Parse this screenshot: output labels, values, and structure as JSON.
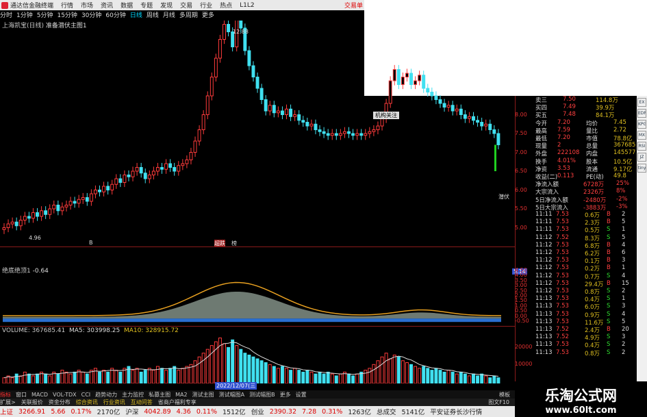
{
  "app": {
    "title": "通达信金融终端",
    "menus": [
      "行情",
      "市场",
      "资讯",
      "数据",
      "专题",
      "发现",
      "交易",
      "行业",
      "热点",
      "L1L2"
    ],
    "trade_label": "交易单"
  },
  "periods": [
    "分时",
    "1分钟",
    "5分钟",
    "15分钟",
    "30分钟",
    "60分钟",
    "日线",
    "周线",
    "月线",
    "多周期",
    "更多"
  ],
  "active_period": "日线",
  "chart": {
    "stock": "上海凯宝(日线)",
    "indicator": "准备潜伏主图1",
    "high_label": "12.88",
    "low_label": "4.96",
    "trend_label": "潜伏",
    "float_tags": [
      "B",
      "超跌",
      "榜"
    ],
    "popup": "机构关注"
  },
  "chart_data": [
    {
      "type": "candlestick",
      "title": "上海凯宝(日线)",
      "ylim": [
        4.5,
        10.5
      ],
      "yticks": [
        10,
        9.5,
        9,
        8.5,
        8,
        7.5,
        7,
        6.5,
        6,
        5.5,
        5
      ],
      "close": [
        5.0,
        5.1,
        5.15,
        5.05,
        5.2,
        5.3,
        5.25,
        5.4,
        5.3,
        5.45,
        5.35,
        5.5,
        5.6,
        5.45,
        5.55,
        5.6,
        5.7,
        5.65,
        5.75,
        5.8,
        5.7,
        5.9,
        6.0,
        5.95,
        6.1,
        6.0,
        6.15,
        6.3,
        6.2,
        6.4,
        6.35,
        6.5,
        6.6,
        6.45,
        6.3,
        6.4,
        6.5,
        6.6,
        6.55,
        6.7,
        6.6,
        6.5,
        6.65,
        6.7,
        6.8,
        7.0,
        7.3,
        7.6,
        8.0,
        8.5,
        9.0,
        9.5,
        10.0,
        10.4,
        10.2,
        9.8,
        10.6,
        10.3,
        9.7,
        9.3,
        9.0,
        8.7,
        8.4,
        8.1,
        8.25,
        8.05,
        8.1,
        8.0,
        8.15,
        7.95,
        8.0,
        7.85,
        7.8,
        7.7,
        7.75,
        7.6,
        7.55,
        7.5,
        7.45,
        7.5,
        7.45,
        7.5,
        7.55,
        7.5,
        7.45,
        7.5,
        7.45,
        7.5,
        7.55,
        7.6,
        7.7,
        7.9,
        8.3,
        8.9,
        9.2,
        8.8,
        9.0,
        9.1,
        8.8,
        8.9,
        9.05,
        8.7,
        8.6,
        8.5,
        8.4,
        8.3,
        8.2,
        8.25,
        8.1,
        8.15,
        8.0,
        7.9,
        7.95,
        7.85,
        7.8,
        7.7,
        7.75,
        7.6,
        7.5,
        7.2
      ],
      "open": [
        4.95,
        5.0,
        5.1,
        5.15,
        5.05,
        5.2,
        5.3,
        5.25,
        5.4,
        5.3,
        5.45,
        5.35,
        5.5,
        5.6,
        5.45,
        5.55,
        5.6,
        5.7,
        5.65,
        5.75,
        5.8,
        5.7,
        5.9,
        6.0,
        5.95,
        6.1,
        6.0,
        6.15,
        6.3,
        6.2,
        6.4,
        6.35,
        6.5,
        6.6,
        6.45,
        6.3,
        6.4,
        6.5,
        6.6,
        6.55,
        6.7,
        6.6,
        6.5,
        6.65,
        6.7,
        6.8,
        7.0,
        7.3,
        7.6,
        8.0,
        8.5,
        9.0,
        9.5,
        10.0,
        10.4,
        10.2,
        9.8,
        10.6,
        10.3,
        9.7,
        9.3,
        9.0,
        8.7,
        8.4,
        8.1,
        8.25,
        8.05,
        8.1,
        8.0,
        8.15,
        7.95,
        8.0,
        7.85,
        7.8,
        7.7,
        7.75,
        7.6,
        7.55,
        7.5,
        7.45,
        7.5,
        7.45,
        7.5,
        7.55,
        7.5,
        7.45,
        7.5,
        7.45,
        7.5,
        7.55,
        7.6,
        7.7,
        7.9,
        8.3,
        8.9,
        9.2,
        8.8,
        9.0,
        9.1,
        8.8,
        8.9,
        9.05,
        8.7,
        8.6,
        8.5,
        8.4,
        8.3,
        8.2,
        8.25,
        8.1,
        8.15,
        8.0,
        7.9,
        7.95,
        7.85,
        7.8,
        7.7,
        7.75,
        7.6,
        7.5
      ],
      "volume": [
        3,
        4,
        3,
        5,
        4,
        6,
        5,
        4,
        5,
        6,
        5,
        4,
        6,
        5,
        7,
        6,
        5,
        6,
        7,
        6,
        5,
        7,
        8,
        6,
        7,
        6,
        8,
        7,
        6,
        8,
        9,
        7,
        8,
        6,
        7,
        8,
        7,
        9,
        8,
        7,
        8,
        9,
        7,
        8,
        9,
        10,
        12,
        14,
        16,
        18,
        20,
        22,
        24,
        21,
        19,
        23,
        20,
        18,
        16,
        15,
        14,
        13,
        12,
        11,
        10,
        9,
        8,
        9,
        8,
        7,
        8,
        7,
        6,
        7,
        6,
        5,
        6,
        5,
        6,
        5,
        4,
        5,
        6,
        5,
        4,
        5,
        6,
        7,
        8,
        10,
        12,
        14,
        16,
        13,
        15,
        14,
        12,
        11,
        10,
        9,
        8,
        9,
        8,
        7,
        8,
        7,
        6,
        7,
        6,
        5,
        6,
        5,
        4,
        5,
        4,
        5,
        4,
        3,
        4,
        3,
        4
      ]
    },
    {
      "type": "area",
      "title": "绝底绝顶1",
      "value_label": "-0.64",
      "yticks": [
        4.5,
        4.0,
        3.5,
        3.0,
        2.5,
        2.0,
        1.5,
        1.0,
        0.5,
        0.0,
        -0.5
      ],
      "current": "5.14"
    },
    {
      "type": "bar",
      "title": "VOLUME",
      "volume": "367685.41",
      "ma5": "303998.25",
      "ma10": "328915.72",
      "yticks": [
        "20000",
        "10000"
      ],
      "date_label": "2022/12/07(三"
    }
  ],
  "quote": {
    "asks": [
      {
        "label": "卖三",
        "price": "7.50",
        "vol": "114.8万"
      },
      {
        "label": "买四",
        "price": "7.49",
        "vol": "39.9万"
      },
      {
        "label": "买五",
        "price": "7.48",
        "vol": "84.1万"
      }
    ],
    "stats": [
      [
        "今开",
        "7.20",
        "均价",
        "7.45"
      ],
      [
        "最高",
        "7.59",
        "量比",
        "2.72"
      ],
      [
        "最低",
        "7.20",
        "市值",
        "78.8亿"
      ],
      [
        "现量",
        "2",
        "总量",
        "367685"
      ],
      [
        "外盘",
        "222108",
        "内盘",
        "145577"
      ],
      [
        "换手",
        "4.01%",
        "股本",
        "10.5亿"
      ],
      [
        "净资",
        "3.53",
        "流通",
        "9.17亿"
      ],
      [
        "收益(二)",
        "0.113",
        "PE(动)",
        "49.8"
      ]
    ],
    "flows": [
      [
        "净流入额",
        "6728万",
        "25%"
      ],
      [
        "大宗流入",
        "2326万",
        "8%"
      ],
      [
        "5日净流入额",
        "-2480万",
        "-2%"
      ],
      [
        "5日大宗流入",
        "-3883万",
        "-3%"
      ]
    ],
    "ticks": [
      [
        "11:11",
        "7.53",
        "0.6万",
        "B",
        "2"
      ],
      [
        "11:11",
        "7.53",
        "2.3万",
        "B",
        "5"
      ],
      [
        "11:11",
        "7.53",
        "0.5万",
        "S",
        "1"
      ],
      [
        "11:12",
        "7.52",
        "8.3万",
        "S",
        "5"
      ],
      [
        "11:12",
        "7.53",
        "6.8万",
        "B",
        "4"
      ],
      [
        "11:12",
        "7.53",
        "6.2万",
        "B",
        "6"
      ],
      [
        "11:12",
        "7.53",
        "0.1万",
        "B",
        "3"
      ],
      [
        "11:12",
        "7.53",
        "0.2万",
        "B",
        "1"
      ],
      [
        "11:12",
        "7.53",
        "0.7万",
        "S",
        "4"
      ],
      [
        "11:12",
        "7.53",
        "29.4万",
        "B",
        "15"
      ],
      [
        "11:12",
        "7.53",
        "0.8万",
        "S",
        "2"
      ],
      [
        "11:13",
        "7.53",
        "0.4万",
        "S",
        "1"
      ],
      [
        "11:13",
        "7.53",
        "6.0万",
        "S",
        "3"
      ],
      [
        "11:13",
        "7.53",
        "0.9万",
        "S",
        "4"
      ],
      [
        "11:13",
        "7.53",
        "11.6万",
        "S",
        "5"
      ],
      [
        "11:13",
        "7.52",
        "2.4万",
        "B",
        "20"
      ],
      [
        "11:13",
        "7.52",
        "4.9万",
        "S",
        "3"
      ],
      [
        "11:13",
        "7.53",
        "0.4万",
        "S",
        "2"
      ],
      [
        "11:13",
        "7.53",
        "0.8万",
        "S",
        "2"
      ]
    ]
  },
  "tabs": [
    "指标",
    "窗口",
    "MACD",
    "VOL-TDX",
    "CCI",
    "趋势动力",
    "主力监控",
    "私募主图",
    "MA2",
    "测试主图",
    "测试幅图A",
    "测试幅图B",
    "更多",
    "设置"
  ],
  "tabs_right": "模板",
  "ext_tabs": [
    "扩展>",
    "关联报价",
    "资金分布",
    "综合资讯",
    "行业资讯",
    "互动问答",
    "省商户福利专享"
  ],
  "ext_right": "图文F10",
  "status": [
    {
      "name": "上证",
      "val": "3266.91",
      "chg": "5.66",
      "pct": "0.17%",
      "amt": "2170亿"
    },
    {
      "name": "沪深",
      "val": "4042.89",
      "chg": "4.36",
      "pct": "0.11%",
      "amt": "1512亿"
    },
    {
      "name": "创业",
      "val": "2390.32",
      "chg": "7.28",
      "pct": "0.31%",
      "amt": "1263亿"
    }
  ],
  "status_total_label": "总成交",
  "status_total": "5141亿",
  "status_broker": "平安证券长沙行情",
  "watermark": {
    "cn": "乐淘公式网",
    "url": "www.60lt.com"
  },
  "toolbar_icons": [
    "EX",
    "EDR",
    "KPG",
    "MX",
    "RSI",
    "JZ",
    "tiny"
  ]
}
